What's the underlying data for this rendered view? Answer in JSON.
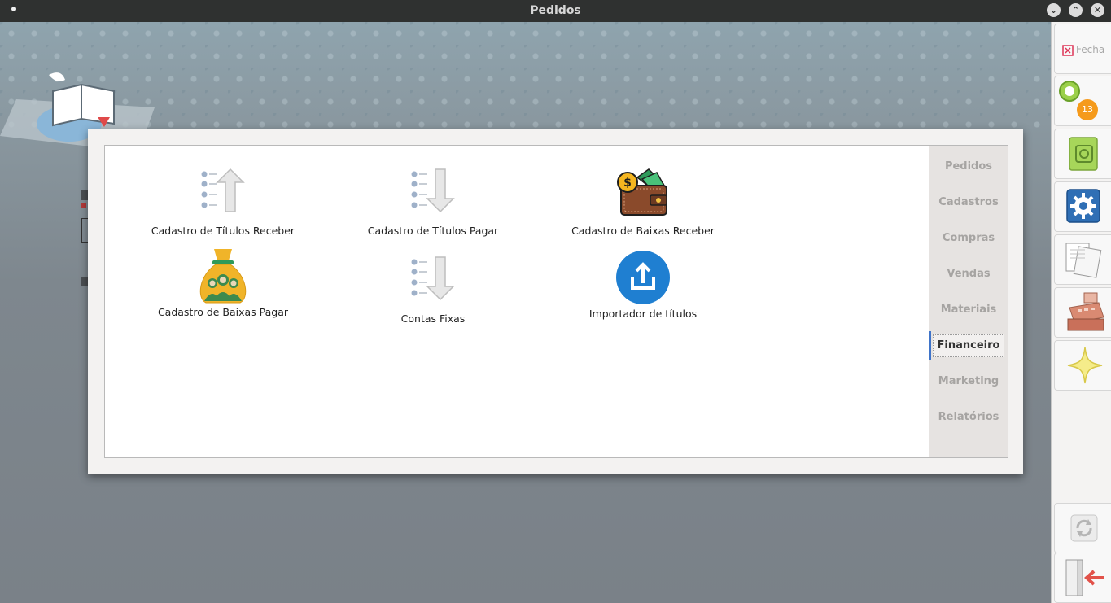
{
  "window": {
    "title": "Pedidos",
    "controls": [
      "minimize",
      "maximize",
      "close"
    ]
  },
  "tiles": [
    {
      "label": "Cadastro de Títulos Receber",
      "icon": "list-arrow-up-icon"
    },
    {
      "label": "Cadastro de Títulos Pagar",
      "icon": "list-arrow-down-icon"
    },
    {
      "label": "Cadastro de Baixas Receber",
      "icon": "wallet-money-icon"
    },
    {
      "label": "Cadastro de Baixas Pagar",
      "icon": "money-bag-icon"
    },
    {
      "label": "Contas Fixas",
      "icon": "list-arrow-down-icon"
    },
    {
      "label": "Importador de títulos",
      "icon": "upload-icon"
    }
  ],
  "tabs": [
    {
      "label": "Pedidos"
    },
    {
      "label": "Cadastros"
    },
    {
      "label": "Compras"
    },
    {
      "label": "Vendas"
    },
    {
      "label": "Materiais"
    },
    {
      "label": "Financeiro",
      "active": true
    },
    {
      "label": "Marketing"
    },
    {
      "label": "Relatórios"
    }
  ],
  "sidebar": {
    "close_label": "Fecha",
    "notification_count": "13",
    "colors": {
      "badge": "#f59a1b",
      "active_tab": "#3f74c9",
      "upload": "#1f7fd1"
    }
  }
}
